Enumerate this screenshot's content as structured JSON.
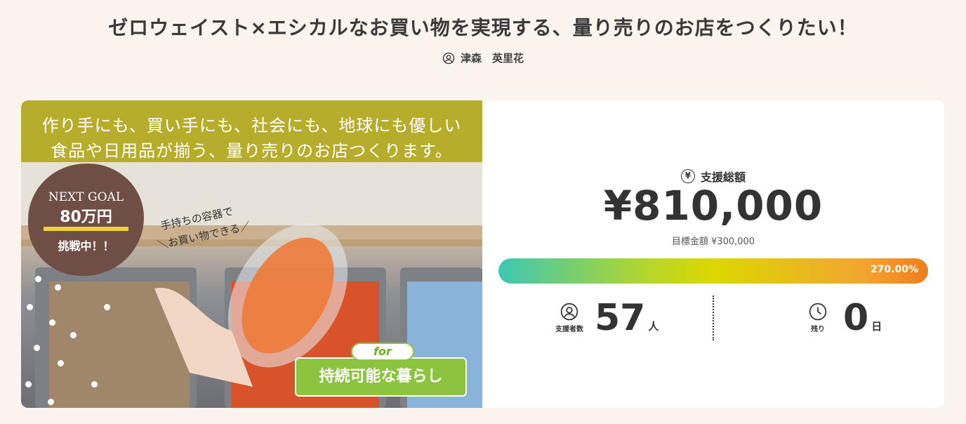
{
  "project": {
    "title": "ゼロウェイスト×エシカルなお買い物を実現する、量り売りのお店をつくりたい！",
    "owner": "津森　英里花"
  },
  "hero": {
    "banner_line1": "作り手にも、買い手にも、社会にも、地球にも優しい",
    "banner_line2": "食品や日用品が揃う、量り売りのお店つくります。",
    "next_goal_label": "NEXT GOAL",
    "next_goal_amount": "80万円",
    "challenge_label": "挑戦中！！",
    "note_line1": "手持ちの容器で",
    "note_line2": "＼お買い物できる／",
    "for_label": "for",
    "sustain_label": "持続可能な暮らし"
  },
  "stats": {
    "total_label": "支援総額",
    "total_amount": "¥810,000",
    "goal_text": "目標金額 ¥300,000",
    "progress_percent": 270.0,
    "progress_label": "270.00%",
    "supporters_label": "支援者数",
    "supporters_count": "57",
    "supporters_unit": "人",
    "remaining_label": "残り",
    "remaining_count": "0",
    "remaining_unit": "日"
  },
  "icons": {
    "owner": "user-icon",
    "total": "yen-icon",
    "supporters": "user-icon",
    "remaining": "clock-icon"
  },
  "colors": {
    "background": "#fbf3ed",
    "banner": "#b7ad2c",
    "badge": "#6e4e45",
    "accent_green": "#8cc43f",
    "progress_start": "#3dc7b3",
    "progress_end": "#ef7d1c"
  }
}
